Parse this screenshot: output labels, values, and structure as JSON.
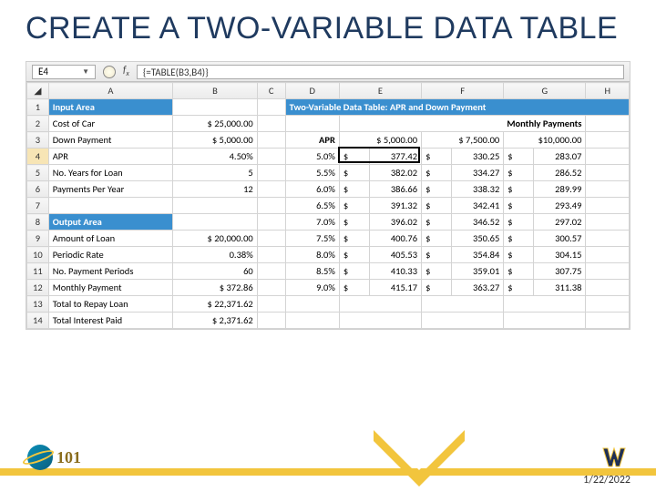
{
  "title": "CREATE A TWO-VARIABLE DATA TABLE",
  "namebox": "E4",
  "formula": "{=TABLE(B3,B4)}",
  "columns": [
    "A",
    "B",
    "C",
    "D",
    "E",
    "F",
    "G",
    "H"
  ],
  "input_header": "Input Area",
  "output_header": "Output Area",
  "two_var_header": "Two-Variable Data Table: APR and Down Payment",
  "monthly_pay_header": "Monthly Payments",
  "input_rows": [
    {
      "label": "Cost of Car",
      "val": "$ 25,000.00"
    },
    {
      "label": "Down Payment",
      "val": "$   5,000.00"
    },
    {
      "label": "APR",
      "val": "4.50%"
    },
    {
      "label": "No. Years for Loan",
      "val": "5"
    },
    {
      "label": "Payments Per Year",
      "val": "12"
    }
  ],
  "output_rows": [
    {
      "label": "Amount of Loan",
      "val": "$ 20,000.00"
    },
    {
      "label": "Periodic Rate",
      "val": "0.38%"
    },
    {
      "label": "No. Payment Periods",
      "val": "60"
    },
    {
      "label": "Monthly Payment",
      "val": "$        372.86"
    },
    {
      "label": "Total to Repay Loan",
      "val": "$ 22,371.62"
    },
    {
      "label": "Total Interest Paid",
      "val": "$   2,371.62"
    }
  ],
  "apr_label": "APR",
  "down_payments": [
    "$  5,000.00",
    "$  7,500.00",
    "$10,000.00"
  ],
  "table": [
    {
      "apr": "5.0%",
      "v": [
        "377.42",
        "330.25",
        "283.07"
      ]
    },
    {
      "apr": "5.5%",
      "v": [
        "382.02",
        "334.27",
        "286.52"
      ]
    },
    {
      "apr": "6.0%",
      "v": [
        "386.66",
        "338.32",
        "289.99"
      ]
    },
    {
      "apr": "6.5%",
      "v": [
        "391.32",
        "342.41",
        "293.49"
      ]
    },
    {
      "apr": "7.0%",
      "v": [
        "396.02",
        "346.52",
        "297.02"
      ]
    },
    {
      "apr": "7.5%",
      "v": [
        "400.76",
        "350.65",
        "300.57"
      ]
    },
    {
      "apr": "8.0%",
      "v": [
        "405.53",
        "354.84",
        "304.15"
      ]
    },
    {
      "apr": "8.5%",
      "v": [
        "410.33",
        "359.01",
        "307.75"
      ]
    },
    {
      "apr": "9.0%",
      "v": [
        "415.17",
        "363.27",
        "311.38"
      ]
    }
  ],
  "footer_date": "1/22/2022"
}
